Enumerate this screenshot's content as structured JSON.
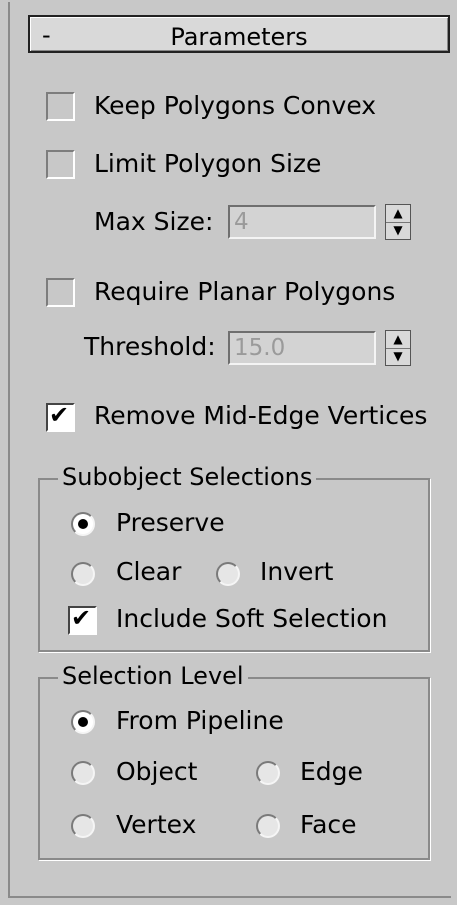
{
  "panel": {
    "header": {
      "collapse_symbol": "-",
      "title": "Parameters"
    },
    "keep_convex": {
      "label": "Keep Polygons Convex",
      "checked": false
    },
    "limit_size": {
      "label": "Limit Polygon Size",
      "checked": false
    },
    "max_size": {
      "label": "Max Size:",
      "value": "4"
    },
    "require_planar": {
      "label": "Require Planar Polygons",
      "checked": false
    },
    "threshold": {
      "label": "Threshold:",
      "value": "15.0"
    },
    "remove_mid_edge": {
      "label": "Remove Mid-Edge Vertices",
      "checked": true,
      "mark": "✔"
    }
  },
  "subobject": {
    "title": "Subobject Selections",
    "preserve": {
      "label": "Preserve",
      "selected": true
    },
    "clear": {
      "label": "Clear",
      "selected": false
    },
    "invert": {
      "label": "Invert",
      "selected": false
    },
    "include_soft": {
      "label": "Include Soft Selection",
      "checked": true,
      "mark": "✔"
    }
  },
  "selection_level": {
    "title": "Selection Level",
    "from_pipeline": {
      "label": "From Pipeline",
      "selected": true
    },
    "object": {
      "label": "Object",
      "selected": false
    },
    "edge": {
      "label": "Edge",
      "selected": false
    },
    "vertex": {
      "label": "Vertex",
      "selected": false
    },
    "face": {
      "label": "Face",
      "selected": false
    }
  },
  "spinner_icons": {
    "up": "▲",
    "down": "▼"
  }
}
